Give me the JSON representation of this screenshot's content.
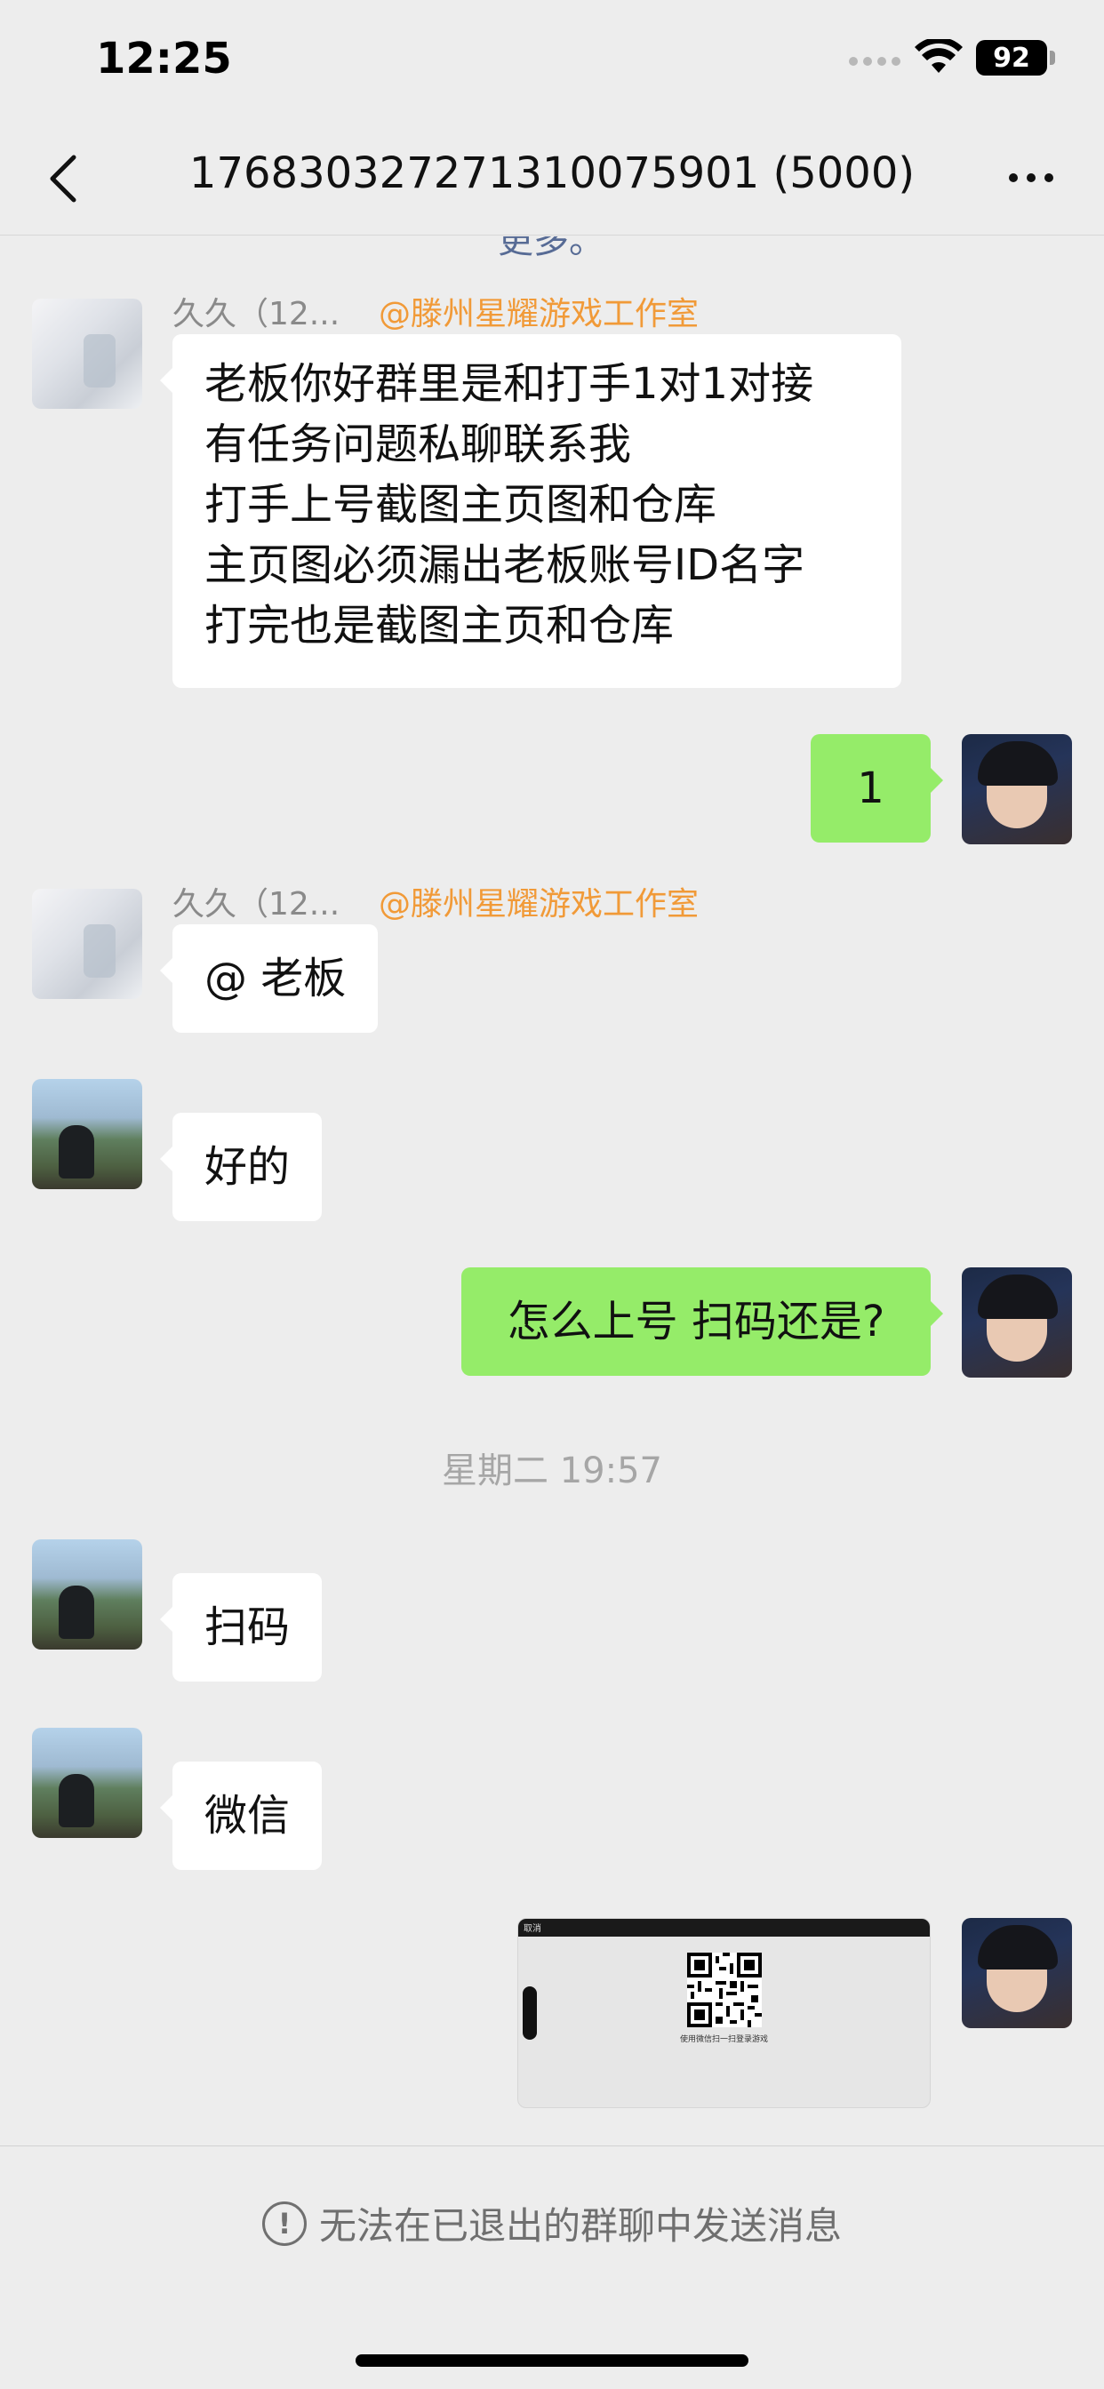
{
  "status_bar": {
    "time": "12:25",
    "battery": "92"
  },
  "nav": {
    "title": "17683032727131007590​1 (5000)"
  },
  "chat": {
    "cut_text": "更多。",
    "messages": [
      {
        "sender": "久久（12...",
        "sender_tag": "@滕州星耀游戏工作室",
        "lines": [
          "老板你好群里是和打手1对1对接",
          "有任务问题私聊联系我",
          "打手上号截图主页图和仓库",
          "主页图必须漏出老板账号ID名字",
          "打完也是截图主页和仓库"
        ]
      },
      {
        "text": "1"
      },
      {
        "sender": "久久（12...",
        "sender_tag": "@滕州星耀游戏工作室",
        "text": "@ 老板"
      },
      {
        "text": "好的"
      },
      {
        "text": "怎么上号 扫码还是?"
      },
      {
        "text": "扫码"
      },
      {
        "text": "微信"
      }
    ],
    "timestamp": "星期二 19:57",
    "image_msg": {
      "cancel": "取消",
      "caption": "使用微信扫一扫登录游戏"
    }
  },
  "notice": {
    "text": "无法在已退出的群聊中发送消息",
    "icon": "exclamation-circle-icon"
  },
  "colors": {
    "bubble_green": "#95ec69",
    "tag_orange": "#f19a38",
    "background": "#ededed"
  }
}
